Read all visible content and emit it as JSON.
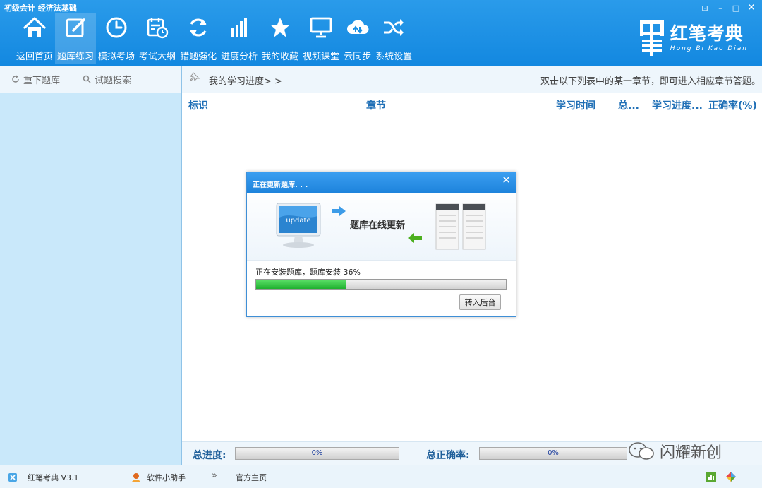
{
  "window": {
    "title": "初级会计 经济法基础",
    "controls": [
      "⊡",
      "–",
      "□",
      "✕"
    ]
  },
  "toolbar": {
    "items": [
      {
        "label": "返回首页",
        "icon": "home-icon"
      },
      {
        "label": "题库练习",
        "icon": "edit-icon",
        "active": true
      },
      {
        "label": "模拟考场",
        "icon": "clock-icon"
      },
      {
        "label": "考试大纲",
        "icon": "calendar-clock-icon"
      },
      {
        "label": "错题强化",
        "icon": "refresh-icon"
      },
      {
        "label": "进度分析",
        "icon": "bar-chart-icon"
      },
      {
        "label": "我的收藏",
        "icon": "star-icon"
      },
      {
        "label": "视频课堂",
        "icon": "monitor-icon"
      },
      {
        "label": "云同步",
        "icon": "cloud-sync-icon"
      },
      {
        "label": "系统设置",
        "icon": "shuffle-icon"
      }
    ]
  },
  "brand": {
    "name_cn": "红笔考典",
    "name_en": "Hong Bi Kao Dian"
  },
  "left_panel": {
    "tabs": [
      {
        "label": "重下题库",
        "icon": "reload-icon"
      },
      {
        "label": "试题搜索",
        "icon": "search-icon"
      }
    ]
  },
  "main": {
    "progress_link": "我的学习进度> >",
    "hint": "双击以下列表中的某一章节，即可进入相应章节答题。",
    "columns": [
      "标识",
      "章节",
      "学习时间",
      "总...",
      "学习进度...",
      "正确率(%)"
    ],
    "total_progress_label": "总进度:",
    "total_progress_value": "0%",
    "total_accuracy_label": "总正确率:",
    "total_accuracy_value": "0%"
  },
  "dialog": {
    "title": "正在更新题库. . .",
    "close": "✕",
    "monitor_text": "update",
    "banner_text": "题库在线更新",
    "status": "正在安装题库，题库安装 36%",
    "progress": 0.36,
    "button": "转入后台"
  },
  "statusbar": {
    "version": "红笔考典 V3.1",
    "helper": "软件小助手",
    "more": "»",
    "homepage": "官方主页",
    "watermark": "闪耀新创"
  },
  "colors": {
    "header": "#1a8fe3",
    "left_panel": "#c9e8fa",
    "column_header_text": "#1f6fb6",
    "progress_green": "#22b231"
  }
}
